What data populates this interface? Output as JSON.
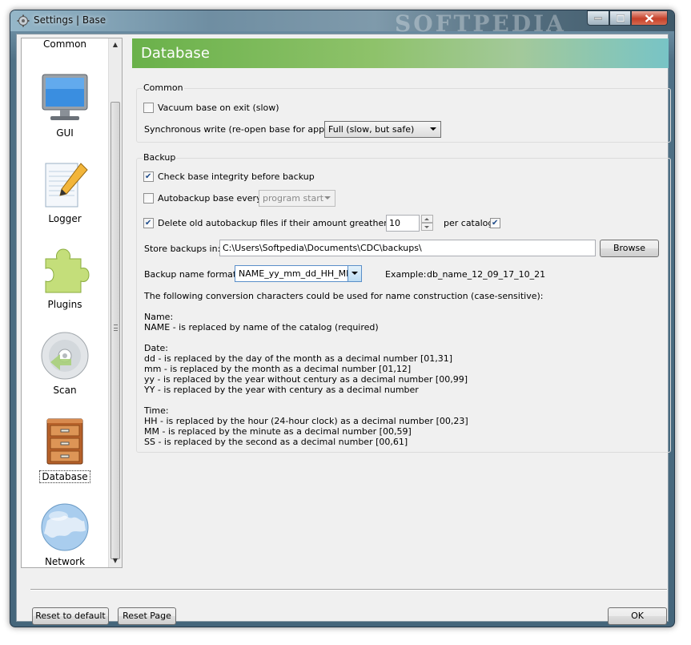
{
  "window": {
    "title": "Settings | Base",
    "watermark": "SOFTPEDIA"
  },
  "sidebar": {
    "items": [
      {
        "label": "Common",
        "icon": "common-icon"
      },
      {
        "label": "GUI",
        "icon": "monitor-icon"
      },
      {
        "label": "Logger",
        "icon": "notepad-pencil-icon"
      },
      {
        "label": "Plugins",
        "icon": "puzzle-piece-icon"
      },
      {
        "label": "Scan",
        "icon": "disc-icon"
      },
      {
        "label": "Database",
        "icon": "filing-cabinet-icon",
        "selected": true
      },
      {
        "label": "Network",
        "icon": "globe-icon"
      }
    ]
  },
  "header": {
    "title": "Database"
  },
  "common_group": {
    "title": "Common",
    "vacuum_label": "Vacuum base on exit (slow)",
    "vacuum_checked": false,
    "sync_label": "Synchronous write (re-open base for apply):",
    "sync_value": "Full (slow, but safe)"
  },
  "backup_group": {
    "title": "Backup",
    "check_integrity_label": "Check base integrity before backup",
    "check_integrity_checked": true,
    "autobackup_label": "Autobackup base every",
    "autobackup_checked": false,
    "autobackup_interval": "program start",
    "delete_old_label": "Delete old autobackup files if their amount greather than",
    "delete_old_checked": true,
    "delete_old_count": "10",
    "per_catalog_label": "per catalog",
    "per_catalog_checked": true,
    "store_label": "Store backups in:",
    "store_path": "C:\\Users\\Softpedia\\Documents\\CDC\\backups\\",
    "browse_label": "Browse",
    "name_format_label": "Backup name format:",
    "name_format_value": "NAME_yy_mm_dd_HH_MM",
    "example_label": "Example:",
    "example_value": "db_name_12_09_17_10_21",
    "help_intro": "The following conversion characters could be used for name construction (case-sensitive):",
    "help_name_title": "Name:",
    "help_name_lines": [
      "NAME - is replaced by name of the catalog (required)"
    ],
    "help_date_title": "Date:",
    "help_date_lines": [
      "dd - is replaced by the day of the month as a decimal number [01,31]",
      "mm - is replaced by the month as a decimal number [01,12]",
      "yy - is replaced by the year without century as a decimal number [00,99]",
      "YY - is replaced by the year with century as a decimal number"
    ],
    "help_time_title": "Time:",
    "help_time_lines": [
      "HH - is replaced by the hour (24-hour clock) as a decimal number [00,23]",
      "MM - is replaced by the minute as a decimal number [00,59]",
      "SS - is replaced by the second as a decimal number [00,61]"
    ]
  },
  "footer": {
    "reset_default_label": "Reset to default",
    "reset_page_label": "Reset Page",
    "ok_label": "OK"
  }
}
